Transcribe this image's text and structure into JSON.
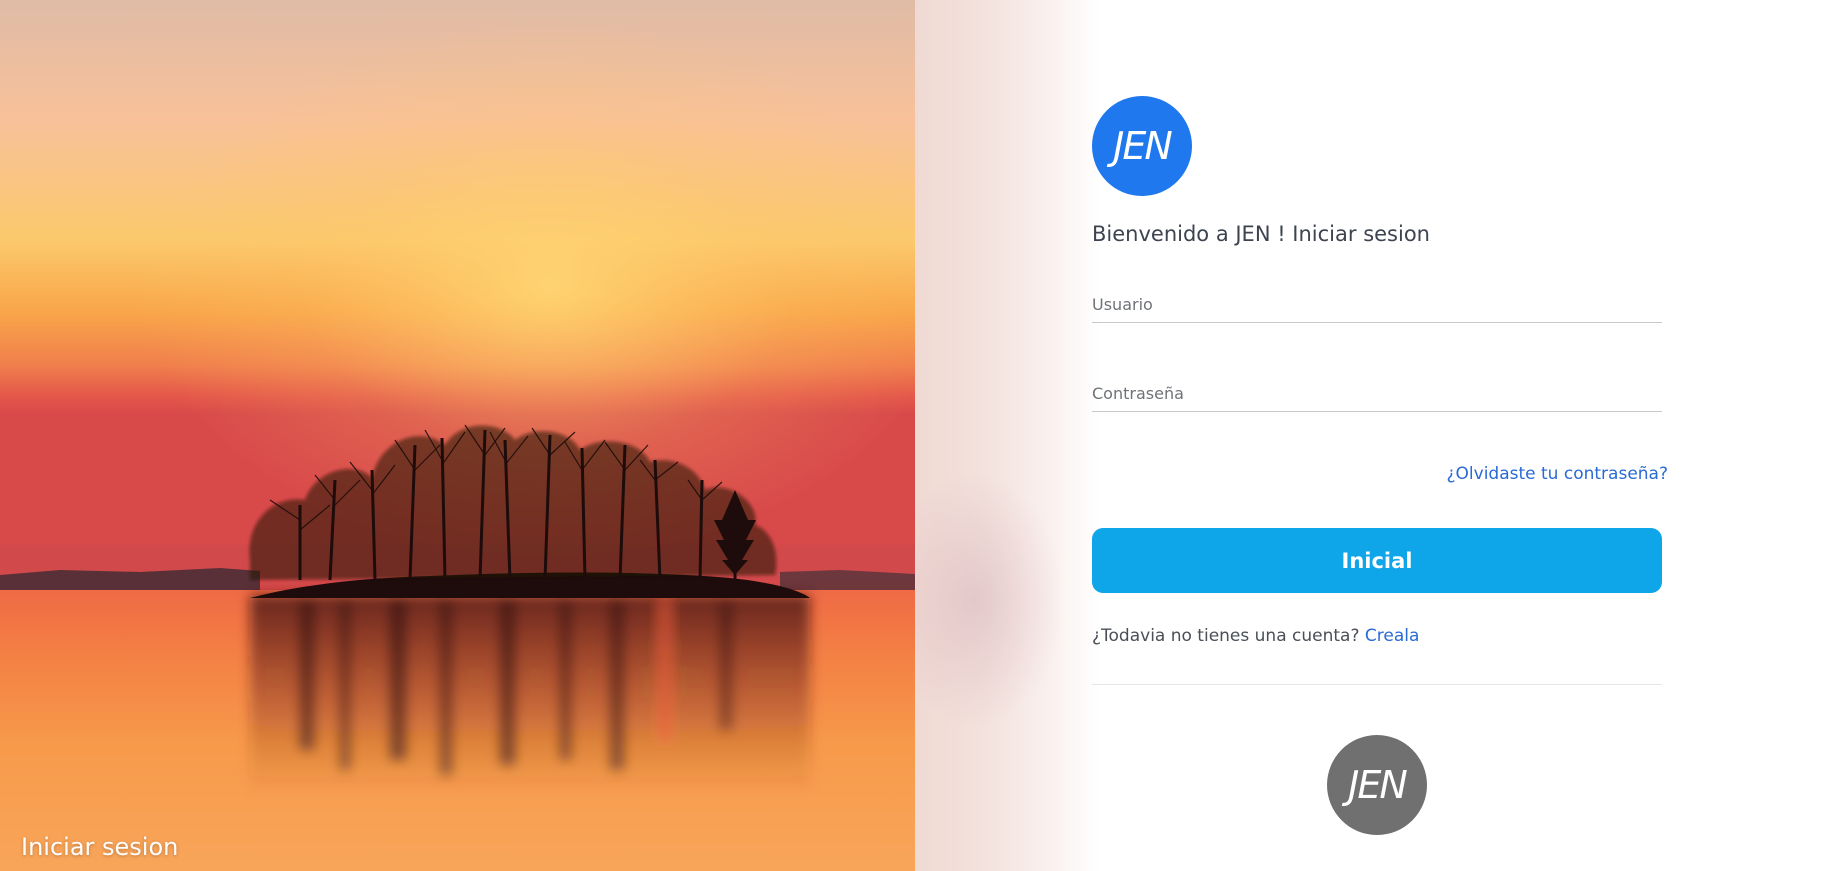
{
  "hero": {
    "caption": "Iniciar sesion",
    "image": "sunset-lake-island-trees"
  },
  "login": {
    "logo_text": "JEN",
    "welcome": "Bienvenido a JEN ! Iniciar sesion",
    "username_placeholder": "Usuario",
    "password_placeholder": "Contraseña",
    "forgot_link": "¿Olvidaste tu contraseña?",
    "submit_label": "Inicial",
    "signup_prompt": "¿Todavia no tienes una cuenta?",
    "signup_link": "Creala",
    "footer_logo_text": "JEN"
  },
  "colors": {
    "primary": "#1f78ee",
    "button": "#0ea5e9",
    "link": "#2a6ad6",
    "footer_logo": "#707070"
  }
}
